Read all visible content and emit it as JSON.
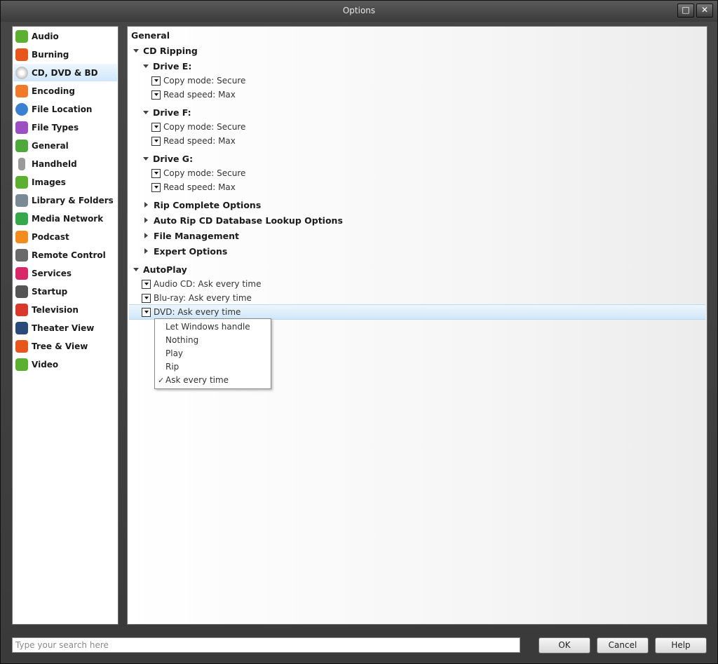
{
  "window": {
    "title": "Options",
    "controls": [
      "□",
      "✕"
    ]
  },
  "sidebar": {
    "items": [
      {
        "label": "Audio",
        "icon": "audio-icon",
        "color": "#5bb030"
      },
      {
        "label": "Burning",
        "icon": "burning-icon",
        "color": "#e8561b"
      },
      {
        "label": "CD, DVD & BD",
        "icon": "disc-icon",
        "color": "#c9c9c9",
        "selected": true
      },
      {
        "label": "Encoding",
        "icon": "encoding-icon",
        "color": "#f07a2a"
      },
      {
        "label": "File Location",
        "icon": "file-location-icon",
        "color": "#3a7fd0"
      },
      {
        "label": "File Types",
        "icon": "file-types-icon",
        "color": "#9b4fc2"
      },
      {
        "label": "General",
        "icon": "general-icon",
        "color": "#4fa83b"
      },
      {
        "label": "Handheld",
        "icon": "handheld-icon",
        "color": "#9a9a9a"
      },
      {
        "label": "Images",
        "icon": "images-icon",
        "color": "#5bb030"
      },
      {
        "label": "Library & Folders",
        "icon": "library-icon",
        "color": "#7a8a95"
      },
      {
        "label": "Media Network",
        "icon": "media-network-icon",
        "color": "#35a84a"
      },
      {
        "label": "Podcast",
        "icon": "podcast-icon",
        "color": "#f28c1e"
      },
      {
        "label": "Remote Control",
        "icon": "remote-control-icon",
        "color": "#6a6a6a"
      },
      {
        "label": "Services",
        "icon": "services-icon",
        "color": "#d9286a"
      },
      {
        "label": "Startup",
        "icon": "startup-icon",
        "color": "#555555"
      },
      {
        "label": "Television",
        "icon": "television-icon",
        "color": "#d9392a"
      },
      {
        "label": "Theater View",
        "icon": "theater-view-icon",
        "color": "#2a4a7a"
      },
      {
        "label": "Tree & View",
        "icon": "tree-view-icon",
        "color": "#e8561b"
      },
      {
        "label": "Video",
        "icon": "video-icon",
        "color": "#5bb030"
      }
    ]
  },
  "main": {
    "section_title": "General",
    "cd_ripping": {
      "label": "CD Ripping",
      "drives": [
        {
          "label": "Drive E:",
          "copy_mode": "Copy mode: Secure",
          "read_speed": "Read speed: Max"
        },
        {
          "label": "Drive F:",
          "copy_mode": "Copy mode: Secure",
          "read_speed": "Read speed: Max"
        },
        {
          "label": "Drive G:",
          "copy_mode": "Copy mode: Secure",
          "read_speed": "Read speed: Max"
        }
      ],
      "collapsed": [
        "Rip Complete Options",
        "Auto Rip CD Database Lookup Options",
        "File Management",
        "Expert Options"
      ]
    },
    "autoplay": {
      "label": "AutoPlay",
      "options": [
        "Audio CD: Ask every time",
        "Blu-ray: Ask every time",
        "DVD: Ask every time"
      ]
    },
    "dropdown": {
      "items": [
        "Let Windows handle",
        "Nothing",
        "Play",
        "Rip",
        "Ask every time"
      ],
      "checked": "✓"
    }
  },
  "footer": {
    "search_placeholder": "Type your search here",
    "ok": "OK",
    "cancel": "Cancel",
    "help": "Help"
  }
}
